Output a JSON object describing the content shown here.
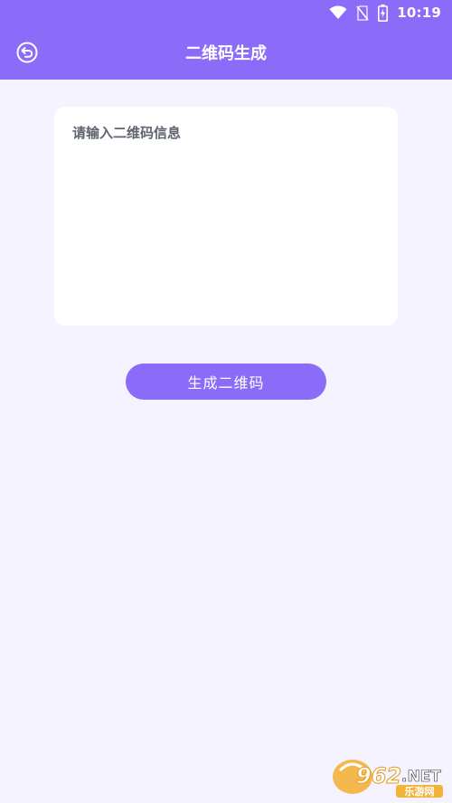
{
  "status_bar": {
    "time": "10:19",
    "icons": [
      "wifi-icon",
      "no-sim-icon",
      "battery-charging-icon"
    ]
  },
  "header": {
    "back_icon": "back-arrow-icon",
    "title": "二维码生成",
    "background_color": "#8a6cf8"
  },
  "input": {
    "placeholder": "请输入二维码信息",
    "value": ""
  },
  "generate_button": {
    "label": "生成二维码",
    "color": "#8a6cf8"
  },
  "watermark": {
    "logo_text": "962.NET",
    "sub_text": "乐游网"
  },
  "colors": {
    "page_background": "#f5f3ff",
    "accent": "#8a6cf8"
  }
}
